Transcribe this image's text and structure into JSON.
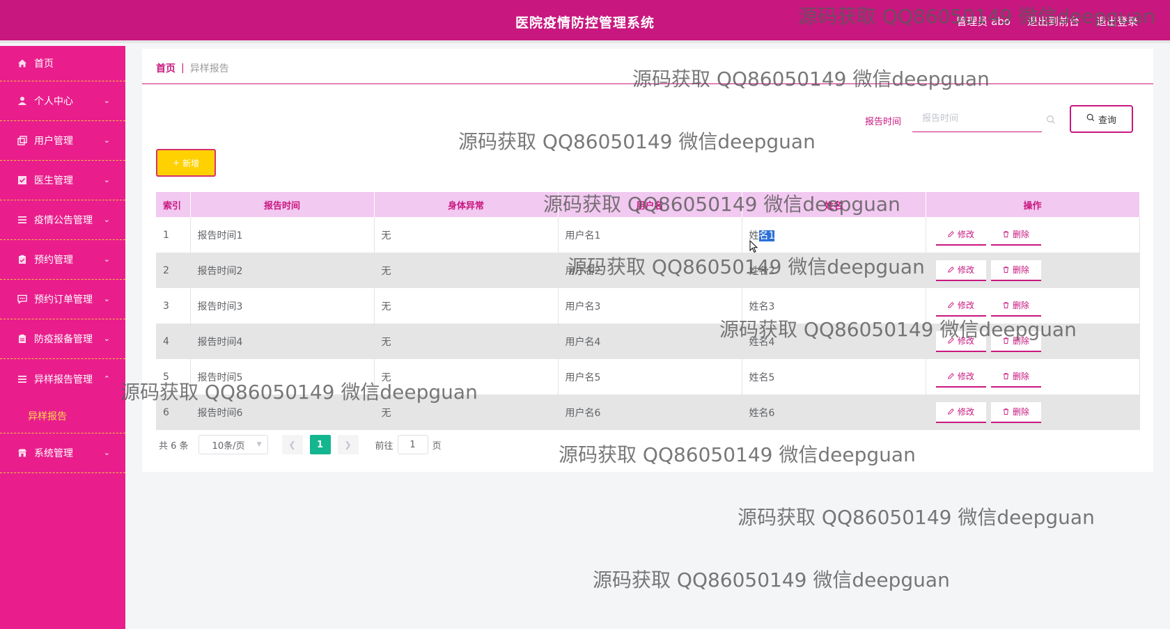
{
  "header": {
    "title": "医院疫情防控管理系统",
    "admin_label": "管理员 abo",
    "back_label": "退出到前台",
    "logout_label": "退出登录"
  },
  "sidebar": {
    "items": [
      {
        "label": "首页",
        "icon": "home-icon"
      },
      {
        "label": "个人中心",
        "icon": "user-icon"
      },
      {
        "label": "用户管理",
        "icon": "copy-icon"
      },
      {
        "label": "医生管理",
        "icon": "checkbox-icon"
      },
      {
        "label": "疫情公告管理",
        "icon": "list-icon"
      },
      {
        "label": "预约管理",
        "icon": "clipboard-check-icon"
      },
      {
        "label": "预约订单管理",
        "icon": "chat-icon"
      },
      {
        "label": "防疫报备管理",
        "icon": "clipboard-icon"
      },
      {
        "label": "异样报告管理",
        "icon": "list-icon"
      },
      {
        "label": "系统管理",
        "icon": "shop-icon"
      }
    ],
    "submenu": {
      "label": "异样报告"
    }
  },
  "breadcrumb": {
    "home": "首页",
    "separator": "|",
    "current": "异样报告"
  },
  "search": {
    "label": "报告时间",
    "placeholder": "报告时间",
    "query_label": "查询"
  },
  "toolbar": {
    "add_label": "新增"
  },
  "table": {
    "headers": [
      "索引",
      "报告时间",
      "身体异常",
      "用户名",
      "姓名",
      "操作"
    ],
    "rows": [
      {
        "index": "1",
        "report_time": "报告时间1",
        "abnormal": "无",
        "username": "用户名1",
        "name": "姓名1"
      },
      {
        "index": "2",
        "report_time": "报告时间2",
        "abnormal": "无",
        "username": "用户名2",
        "name": "姓名2"
      },
      {
        "index": "3",
        "report_time": "报告时间3",
        "abnormal": "无",
        "username": "用户名3",
        "name": "姓名3"
      },
      {
        "index": "4",
        "report_time": "报告时间4",
        "abnormal": "无",
        "username": "用户名4",
        "name": "姓名4"
      },
      {
        "index": "5",
        "report_time": "报告时间5",
        "abnormal": "无",
        "username": "用户名5",
        "name": "姓名5"
      },
      {
        "index": "6",
        "report_time": "报告时间6",
        "abnormal": "无",
        "username": "用户名6",
        "name": "姓名6"
      }
    ],
    "edit_label": "修改",
    "delete_label": "删除"
  },
  "pagination": {
    "total": "共 6 条",
    "page_size": "10条/页",
    "current_page": "1",
    "goto_label": "前往",
    "goto_value": "1",
    "page_suffix": "页"
  },
  "watermark": "源码获取 QQ86050149 微信deepguan",
  "colors": {
    "brand": "#c8177f",
    "sidebar": "#e91e8c",
    "accent": "#ffd100",
    "pager_active": "#13b68e"
  }
}
